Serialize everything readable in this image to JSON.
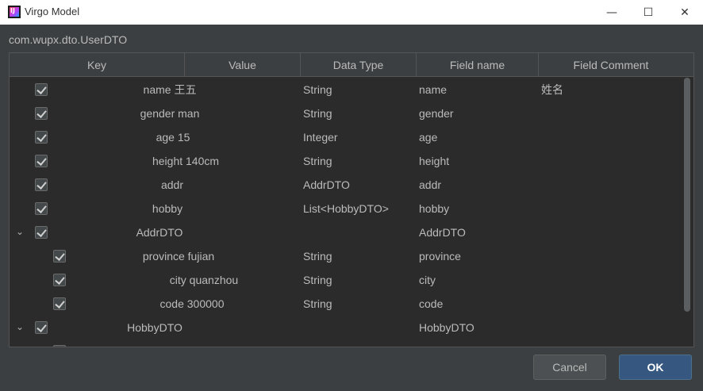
{
  "window": {
    "title": "Virgo Model",
    "minimize_glyph": "—",
    "maximize_glyph": "☐",
    "close_glyph": "✕"
  },
  "class_name": "com.wupx.dto.UserDTO",
  "table": {
    "columns": [
      "Key",
      "Value",
      "Data Type",
      "Field name",
      "Field Comment"
    ],
    "rows": [
      {
        "key": "name 王五",
        "data_type": "String",
        "field_name": "name",
        "field_comment": "姓名",
        "checked": true,
        "expandable": false,
        "level": 0
      },
      {
        "key": "gender man",
        "data_type": "String",
        "field_name": "gender",
        "field_comment": "",
        "checked": true,
        "expandable": false,
        "level": 0
      },
      {
        "key": "age 15",
        "data_type": "Integer",
        "field_name": "age",
        "field_comment": "",
        "checked": true,
        "expandable": false,
        "level": 0
      },
      {
        "key": "height 140cm",
        "data_type": "String",
        "field_name": "height",
        "field_comment": "",
        "checked": true,
        "expandable": false,
        "level": 0
      },
      {
        "key": "addr",
        "data_type": "AddrDTO",
        "field_name": "addr",
        "field_comment": "",
        "checked": true,
        "expandable": false,
        "level": 0
      },
      {
        "key": "hobby",
        "data_type": "List<HobbyDTO>",
        "field_name": "hobby",
        "field_comment": "",
        "checked": true,
        "expandable": false,
        "level": 0
      },
      {
        "key": "AddrDTO",
        "data_type": "",
        "field_name": "AddrDTO",
        "field_comment": "",
        "checked": true,
        "expandable": true,
        "level": 0
      },
      {
        "key": "province fujian",
        "data_type": "String",
        "field_name": "province",
        "field_comment": "",
        "checked": true,
        "expandable": false,
        "level": 1
      },
      {
        "key": "city quanzhou",
        "data_type": "String",
        "field_name": "city",
        "field_comment": "",
        "checked": true,
        "expandable": false,
        "level": 1
      },
      {
        "key": "code 300000",
        "data_type": "String",
        "field_name": "code",
        "field_comment": "",
        "checked": true,
        "expandable": false,
        "level": 1
      },
      {
        "key": "HobbyDTO",
        "data_type": "",
        "field_name": "HobbyDTO",
        "field_comment": "",
        "checked": true,
        "expandable": true,
        "level": 0
      }
    ]
  },
  "buttons": {
    "cancel": "Cancel",
    "ok": "OK"
  }
}
